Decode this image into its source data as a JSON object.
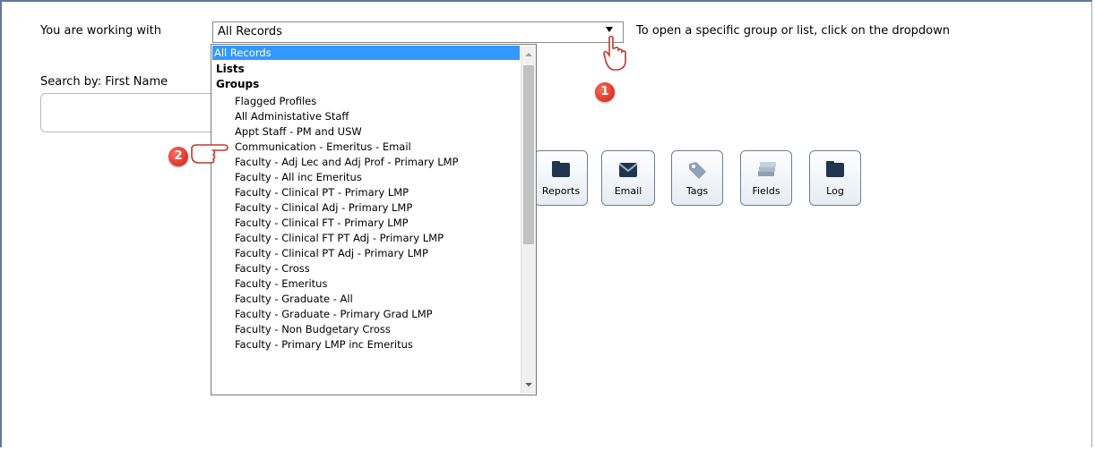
{
  "header": {
    "working_label": "You are working with",
    "selected_value": "All Records",
    "hint": "To open a specific group or list, click on the dropdown"
  },
  "search": {
    "label": "Search by: First Name"
  },
  "dropdown": {
    "selected": "All Records",
    "headings": [
      "Lists",
      "Groups"
    ],
    "items": [
      "Flagged Profiles",
      "All Administative Staff",
      "Appt Staff - PM and USW",
      "Communication - Emeritus - Email",
      "Faculty - Adj Lec and Adj Prof - Primary LMP",
      "Faculty - All inc Emeritus",
      "Faculty - Clinical PT - Primary LMP",
      "Faculty - Clinical Adj - Primary LMP",
      "Faculty - Clinical FT - Primary LMP",
      "Faculty - Clinical FT PT Adj - Primary LMP",
      "Faculty - Clinical PT Adj - Primary LMP",
      "Faculty - Cross",
      "Faculty - Emeritus",
      "Faculty - Graduate - All",
      "Faculty - Graduate - Primary Grad LMP",
      "Faculty - Non Budgetary Cross",
      "Faculty - Primary LMP inc Emeritus"
    ]
  },
  "toolbar": {
    "reports": "Reports",
    "email": "Email",
    "tags": "Tags",
    "fields": "Fields",
    "log": "Log"
  },
  "callouts": {
    "one": "1",
    "two": "2"
  }
}
